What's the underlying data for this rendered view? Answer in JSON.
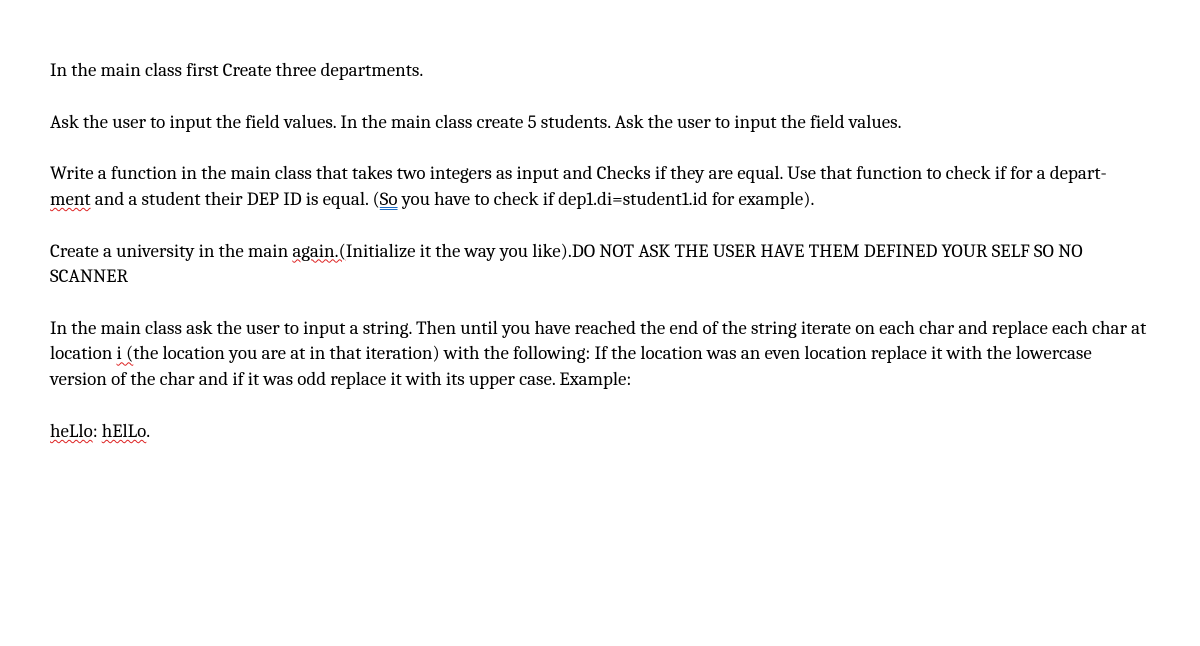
{
  "paragraphs": {
    "p1": "In the main class first Create three departments.",
    "p2": "Ask the user to input the field values. In the main class create 5 students. Ask the user to input the field values.",
    "p3_part1": "Write a function in the main class that takes two integers as input and Checks if they are equal. Use that function to check if for a depart- ",
    "p3_ment": "ment",
    "p3_part2": " and a student their DEP ID is equal. (",
    "p3_so": "So",
    "p3_part3": " you have to check if dep1.di=student1.id for example).",
    "p4_part1": "Create a university in the main ",
    "p4_again": "again.(",
    "p4_part2": "Initialize it the way you like).DO NOT ASK THE USER HAVE THEM DEFINED YOUR SELF SO NO SCANNER",
    "p5_part1": "In the main class ask the user to input a string. Then until you have reached the end of the string iterate on each char and replace each char at location ",
    "p5_i": "i (",
    "p5_part2": "the location you are at in that iteration) with the following: If the location was an even location replace it with the lowercase version of the char and if it was odd replace it with its upper case. Example:",
    "p6_hello1": "heLlo",
    "p6_colon": ": ",
    "p6_hello2": "hElLo",
    "p6_period": "."
  }
}
